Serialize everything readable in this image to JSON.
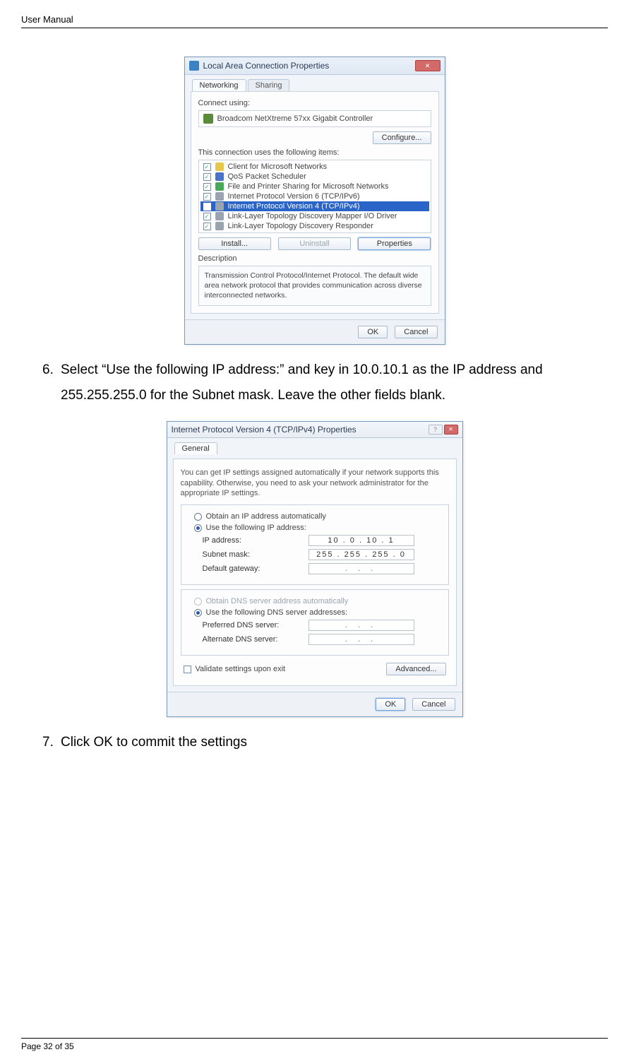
{
  "page": {
    "header_title": "User Manual",
    "footer": "Page 32 of 35"
  },
  "steps": {
    "s6_num": "6.",
    "s6_text": "Select “Use the following IP address:” and key in 10.0.10.1 as the IP address and 255.255.255.0 for the Subnet mask. Leave the other fields blank.",
    "s7_num": "7.",
    "s7_text": "Click OK to commit the settings"
  },
  "dlg1": {
    "title": "Local Area Connection Properties",
    "tab_networking": "Networking",
    "tab_sharing": "Sharing",
    "connect_using": "Connect using:",
    "adapter": "Broadcom NetXtreme 57xx Gigabit Controller",
    "configure_btn": "Configure...",
    "items_label": "This connection uses the following items:",
    "items": [
      "Client for Microsoft Networks",
      "QoS Packet Scheduler",
      "File and Printer Sharing for Microsoft Networks",
      "Internet Protocol Version 6 (TCP/IPv6)",
      "Internet Protocol Version 4 (TCP/IPv4)",
      "Link-Layer Topology Discovery Mapper I/O Driver",
      "Link-Layer Topology Discovery Responder"
    ],
    "install_btn": "Install...",
    "uninstall_btn": "Uninstall",
    "properties_btn": "Properties",
    "desc_label": "Description",
    "desc_text": "Transmission Control Protocol/Internet Protocol. The default wide area network protocol that provides communication across diverse interconnected networks.",
    "ok_btn": "OK",
    "cancel_btn": "Cancel"
  },
  "dlg2": {
    "title": "Internet Protocol Version 4 (TCP/IPv4) Properties",
    "tab_general": "General",
    "help_text": "You can get IP settings assigned automatically if your network supports this capability. Otherwise, you need to ask your network administrator for the appropriate IP settings.",
    "radio_auto_ip": "Obtain an IP address automatically",
    "radio_manual_ip": "Use the following IP address:",
    "ip_label": "IP address:",
    "ip_value": "10 . 0 . 10 . 1",
    "subnet_label": "Subnet mask:",
    "subnet_value": "255 . 255 . 255 . 0",
    "gateway_label": "Default gateway:",
    "gateway_value": ".   .   .",
    "radio_auto_dns": "Obtain DNS server address automatically",
    "radio_manual_dns": "Use the following DNS server addresses:",
    "pref_dns_label": "Preferred DNS server:",
    "pref_dns_value": ".   .   .",
    "alt_dns_label": "Alternate DNS server:",
    "alt_dns_value": ".   .   .",
    "validate_label": "Validate settings upon exit",
    "advanced_btn": "Advanced...",
    "ok_btn": "OK",
    "cancel_btn": "Cancel"
  }
}
